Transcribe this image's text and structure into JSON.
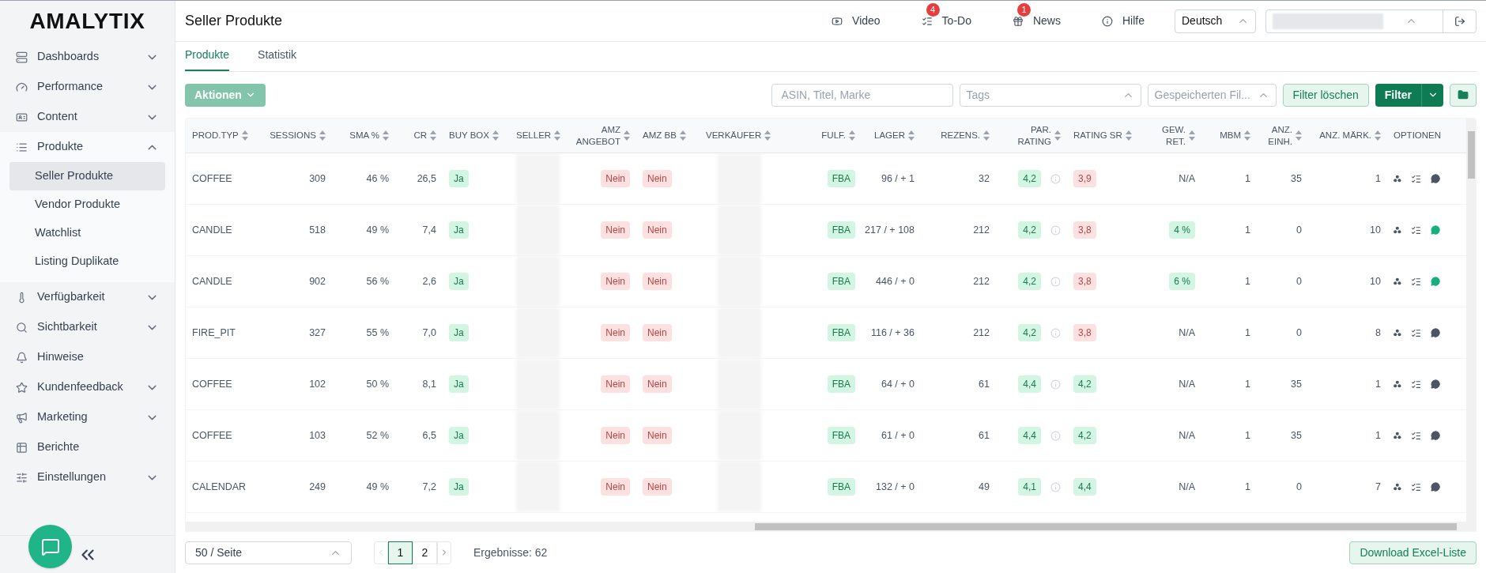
{
  "logo": "AMALYTIX",
  "sidebar": {
    "items": [
      {
        "label": "Dashboards",
        "expanded": false
      },
      {
        "label": "Performance",
        "expanded": false
      },
      {
        "label": "Content",
        "expanded": false
      },
      {
        "label": "Produkte",
        "expanded": true,
        "children": [
          {
            "label": "Seller Produkte",
            "selected": true
          },
          {
            "label": "Vendor Produkte",
            "selected": false
          },
          {
            "label": "Watchlist",
            "selected": false
          },
          {
            "label": "Listing Duplikate",
            "selected": false
          }
        ]
      },
      {
        "label": "Verfügbarkeit",
        "expanded": false
      },
      {
        "label": "Sichtbarkeit",
        "expanded": false
      },
      {
        "label": "Hinweise"
      },
      {
        "label": "Kundenfeedback",
        "expanded": false
      },
      {
        "label": "Marketing",
        "expanded": false
      },
      {
        "label": "Berichte"
      },
      {
        "label": "Einstellungen",
        "expanded": false
      }
    ]
  },
  "header": {
    "title": "Seller Produkte",
    "nav": [
      {
        "label": "Video"
      },
      {
        "label": "To-Do",
        "badge": "4"
      },
      {
        "label": "News",
        "badge": "1"
      },
      {
        "label": "Hilfe"
      }
    ],
    "language": "Deutsch"
  },
  "tabs": [
    {
      "label": "Produkte",
      "selected": true
    },
    {
      "label": "Statistik",
      "selected": false
    }
  ],
  "toolbar": {
    "actions": "Aktionen",
    "search_placeholder": "ASIN, Titel, Marke",
    "tags_placeholder": "Tags",
    "saved_filter_placeholder": "Gespeicherten Fil...",
    "clear": "Filter löschen",
    "filter": "Filter"
  },
  "table": {
    "columns": [
      {
        "label": "PROD.TYP",
        "sortable": true
      },
      {
        "label": "SESSIONS",
        "sortable": true
      },
      {
        "label": "SMA %",
        "sortable": true
      },
      {
        "label": "CR",
        "sortable": true
      },
      {
        "label": "BUY BOX",
        "sortable": true
      },
      {
        "label": "SELLER",
        "sortable": true
      },
      {
        "label": "AMZ ANGEBOT",
        "sortable": true
      },
      {
        "label": "AMZ BB",
        "sortable": true
      },
      {
        "label": "VERKÄUFER",
        "sortable": true
      },
      {
        "label": "FULF.",
        "sortable": true
      },
      {
        "label": "LAGER",
        "sortable": true
      },
      {
        "label": "REZENS.",
        "sortable": true
      },
      {
        "label": "PAR. RATING",
        "sortable": true
      },
      {
        "label": "RATING SR",
        "sortable": true
      },
      {
        "label": "GEW. RET.",
        "sortable": true
      },
      {
        "label": "MBM",
        "sortable": true
      },
      {
        "label": "ANZ. EINH.",
        "sortable": true
      },
      {
        "label": "ANZ. MÄRK.",
        "sortable": true
      },
      {
        "label": "OPTIONEN",
        "sortable": false
      }
    ],
    "rows": [
      {
        "cells": [
          {
            "text": "COFFEE"
          },
          {
            "text": "309"
          },
          {
            "text": "46 %"
          },
          {
            "text": "26,5"
          },
          {
            "kind": "badge",
            "text": "Ja",
            "color": "#d3f5e3"
          },
          {
            "kind": "blurred"
          },
          {
            "kind": "badge",
            "text": "Nein",
            "color": "#fde1e1"
          },
          {
            "kind": "badge",
            "text": "Nein",
            "color": "#fde1e1"
          },
          {
            "kind": "blurred"
          },
          {
            "kind": "badge",
            "text": "FBA",
            "color": "#d3f5e3"
          },
          {
            "text": "96 / + 1"
          },
          {
            "text": "32"
          },
          {
            "kind": "rating",
            "text": "4,2",
            "color": "#d3f5e3"
          },
          {
            "kind": "badge",
            "text": "3,9",
            "color": "#fde1e1"
          },
          {
            "text": "N/A"
          },
          {
            "text": "1"
          },
          {
            "text": "35"
          },
          {
            "text": "1"
          },
          {
            "kind": "options",
            "comments": false
          }
        ]
      },
      {
        "cells": [
          {
            "text": "CANDLE"
          },
          {
            "text": "518"
          },
          {
            "text": "49 %"
          },
          {
            "text": "7,4"
          },
          {
            "kind": "badge",
            "text": "Ja",
            "color": "#d3f5e3"
          },
          {
            "kind": "blurred"
          },
          {
            "kind": "badge",
            "text": "Nein",
            "color": "#fde1e1"
          },
          {
            "kind": "badge",
            "text": "Nein",
            "color": "#fde1e1"
          },
          {
            "kind": "blurred"
          },
          {
            "kind": "badge",
            "text": "FBA",
            "color": "#d3f5e3"
          },
          {
            "text": "217 / + 108"
          },
          {
            "text": "212"
          },
          {
            "kind": "rating",
            "text": "4,2",
            "color": "#d3f5e3"
          },
          {
            "kind": "badge",
            "text": "3,8",
            "color": "#fde1e1"
          },
          {
            "kind": "badge",
            "text": "4 %",
            "color": "#d3f5e3"
          },
          {
            "text": "1"
          },
          {
            "text": "0"
          },
          {
            "text": "10"
          },
          {
            "kind": "options",
            "comments": true
          }
        ]
      },
      {
        "cells": [
          {
            "text": "CANDLE"
          },
          {
            "text": "902"
          },
          {
            "text": "56 %"
          },
          {
            "text": "2,6"
          },
          {
            "kind": "badge",
            "text": "Ja",
            "color": "#d3f5e3"
          },
          {
            "kind": "blurred"
          },
          {
            "kind": "badge",
            "text": "Nein",
            "color": "#fde1e1"
          },
          {
            "kind": "badge",
            "text": "Nein",
            "color": "#fde1e1"
          },
          {
            "kind": "blurred"
          },
          {
            "kind": "badge",
            "text": "FBA",
            "color": "#d3f5e3"
          },
          {
            "text": "446 / + 0"
          },
          {
            "text": "212"
          },
          {
            "kind": "rating",
            "text": "4,2",
            "color": "#d3f5e3"
          },
          {
            "kind": "badge",
            "text": "3,8",
            "color": "#fde1e1"
          },
          {
            "kind": "badge",
            "text": "6 %",
            "color": "#d3f5e3"
          },
          {
            "text": "1"
          },
          {
            "text": "0"
          },
          {
            "text": "10"
          },
          {
            "kind": "options",
            "comments": true
          }
        ]
      },
      {
        "cells": [
          {
            "text": "FIRE_PIT"
          },
          {
            "text": "327"
          },
          {
            "text": "55 %"
          },
          {
            "text": "7,0"
          },
          {
            "kind": "badge",
            "text": "Ja",
            "color": "#d3f5e3"
          },
          {
            "kind": "blurred"
          },
          {
            "kind": "badge",
            "text": "Nein",
            "color": "#fde1e1"
          },
          {
            "kind": "badge",
            "text": "Nein",
            "color": "#fde1e1"
          },
          {
            "kind": "blurred"
          },
          {
            "kind": "badge",
            "text": "FBA",
            "color": "#d3f5e3"
          },
          {
            "text": "116 / + 36"
          },
          {
            "text": "212"
          },
          {
            "kind": "rating",
            "text": "4,2",
            "color": "#d3f5e3"
          },
          {
            "kind": "badge",
            "text": "3,8",
            "color": "#fde1e1"
          },
          {
            "text": "N/A"
          },
          {
            "text": "1"
          },
          {
            "text": "0"
          },
          {
            "text": "8"
          },
          {
            "kind": "options",
            "comments": false
          }
        ]
      },
      {
        "cells": [
          {
            "text": "COFFEE"
          },
          {
            "text": "102"
          },
          {
            "text": "50 %"
          },
          {
            "text": "8,1"
          },
          {
            "kind": "badge",
            "text": "Ja",
            "color": "#d3f5e3"
          },
          {
            "kind": "blurred"
          },
          {
            "kind": "badge",
            "text": "Nein",
            "color": "#fde1e1"
          },
          {
            "kind": "badge",
            "text": "Nein",
            "color": "#fde1e1"
          },
          {
            "kind": "blurred"
          },
          {
            "kind": "badge",
            "text": "FBA",
            "color": "#d3f5e3"
          },
          {
            "text": "64 / + 0"
          },
          {
            "text": "61"
          },
          {
            "kind": "rating",
            "text": "4,4",
            "color": "#d3f5e3"
          },
          {
            "kind": "badge",
            "text": "4,2",
            "color": "#d3f5e3"
          },
          {
            "text": "N/A"
          },
          {
            "text": "1"
          },
          {
            "text": "35"
          },
          {
            "text": "1"
          },
          {
            "kind": "options",
            "comments": false
          }
        ]
      },
      {
        "cells": [
          {
            "text": "COFFEE"
          },
          {
            "text": "103"
          },
          {
            "text": "52 %"
          },
          {
            "text": "6,5"
          },
          {
            "kind": "badge",
            "text": "Ja",
            "color": "#d3f5e3"
          },
          {
            "kind": "blurred"
          },
          {
            "kind": "badge",
            "text": "Nein",
            "color": "#fde1e1"
          },
          {
            "kind": "badge",
            "text": "Nein",
            "color": "#fde1e1"
          },
          {
            "kind": "blurred"
          },
          {
            "kind": "badge",
            "text": "FBA",
            "color": "#d3f5e3"
          },
          {
            "text": "61 / + 0"
          },
          {
            "text": "61"
          },
          {
            "kind": "rating",
            "text": "4,4",
            "color": "#d3f5e3"
          },
          {
            "kind": "badge",
            "text": "4,2",
            "color": "#d3f5e3"
          },
          {
            "text": "N/A"
          },
          {
            "text": "1"
          },
          {
            "text": "35"
          },
          {
            "text": "1"
          },
          {
            "kind": "options",
            "comments": false
          }
        ]
      },
      {
        "cells": [
          {
            "text": "CALENDAR"
          },
          {
            "text": "249"
          },
          {
            "text": "49 %"
          },
          {
            "text": "7,2"
          },
          {
            "kind": "badge",
            "text": "Ja",
            "color": "#d3f5e3"
          },
          {
            "kind": "blurred"
          },
          {
            "kind": "badge",
            "text": "Nein",
            "color": "#fde1e1"
          },
          {
            "kind": "badge",
            "text": "Nein",
            "color": "#fde1e1"
          },
          {
            "kind": "blurred"
          },
          {
            "kind": "badge",
            "text": "FBA",
            "color": "#d3f5e3"
          },
          {
            "text": "132 / + 0"
          },
          {
            "text": "49"
          },
          {
            "kind": "rating",
            "text": "4,1",
            "color": "#d3f5e3"
          },
          {
            "kind": "badge",
            "text": "4,4",
            "color": "#d3f5e3"
          },
          {
            "text": "N/A"
          },
          {
            "text": "1"
          },
          {
            "text": "0"
          },
          {
            "text": "7"
          },
          {
            "kind": "options",
            "comments": false
          }
        ]
      }
    ]
  },
  "footer": {
    "page_size": "50 / Seite",
    "pages": [
      {
        "label": "1",
        "selected": true
      },
      {
        "label": "2",
        "selected": false
      }
    ],
    "results": "Ergebnisse: 62",
    "download": "Download Excel-Liste"
  }
}
